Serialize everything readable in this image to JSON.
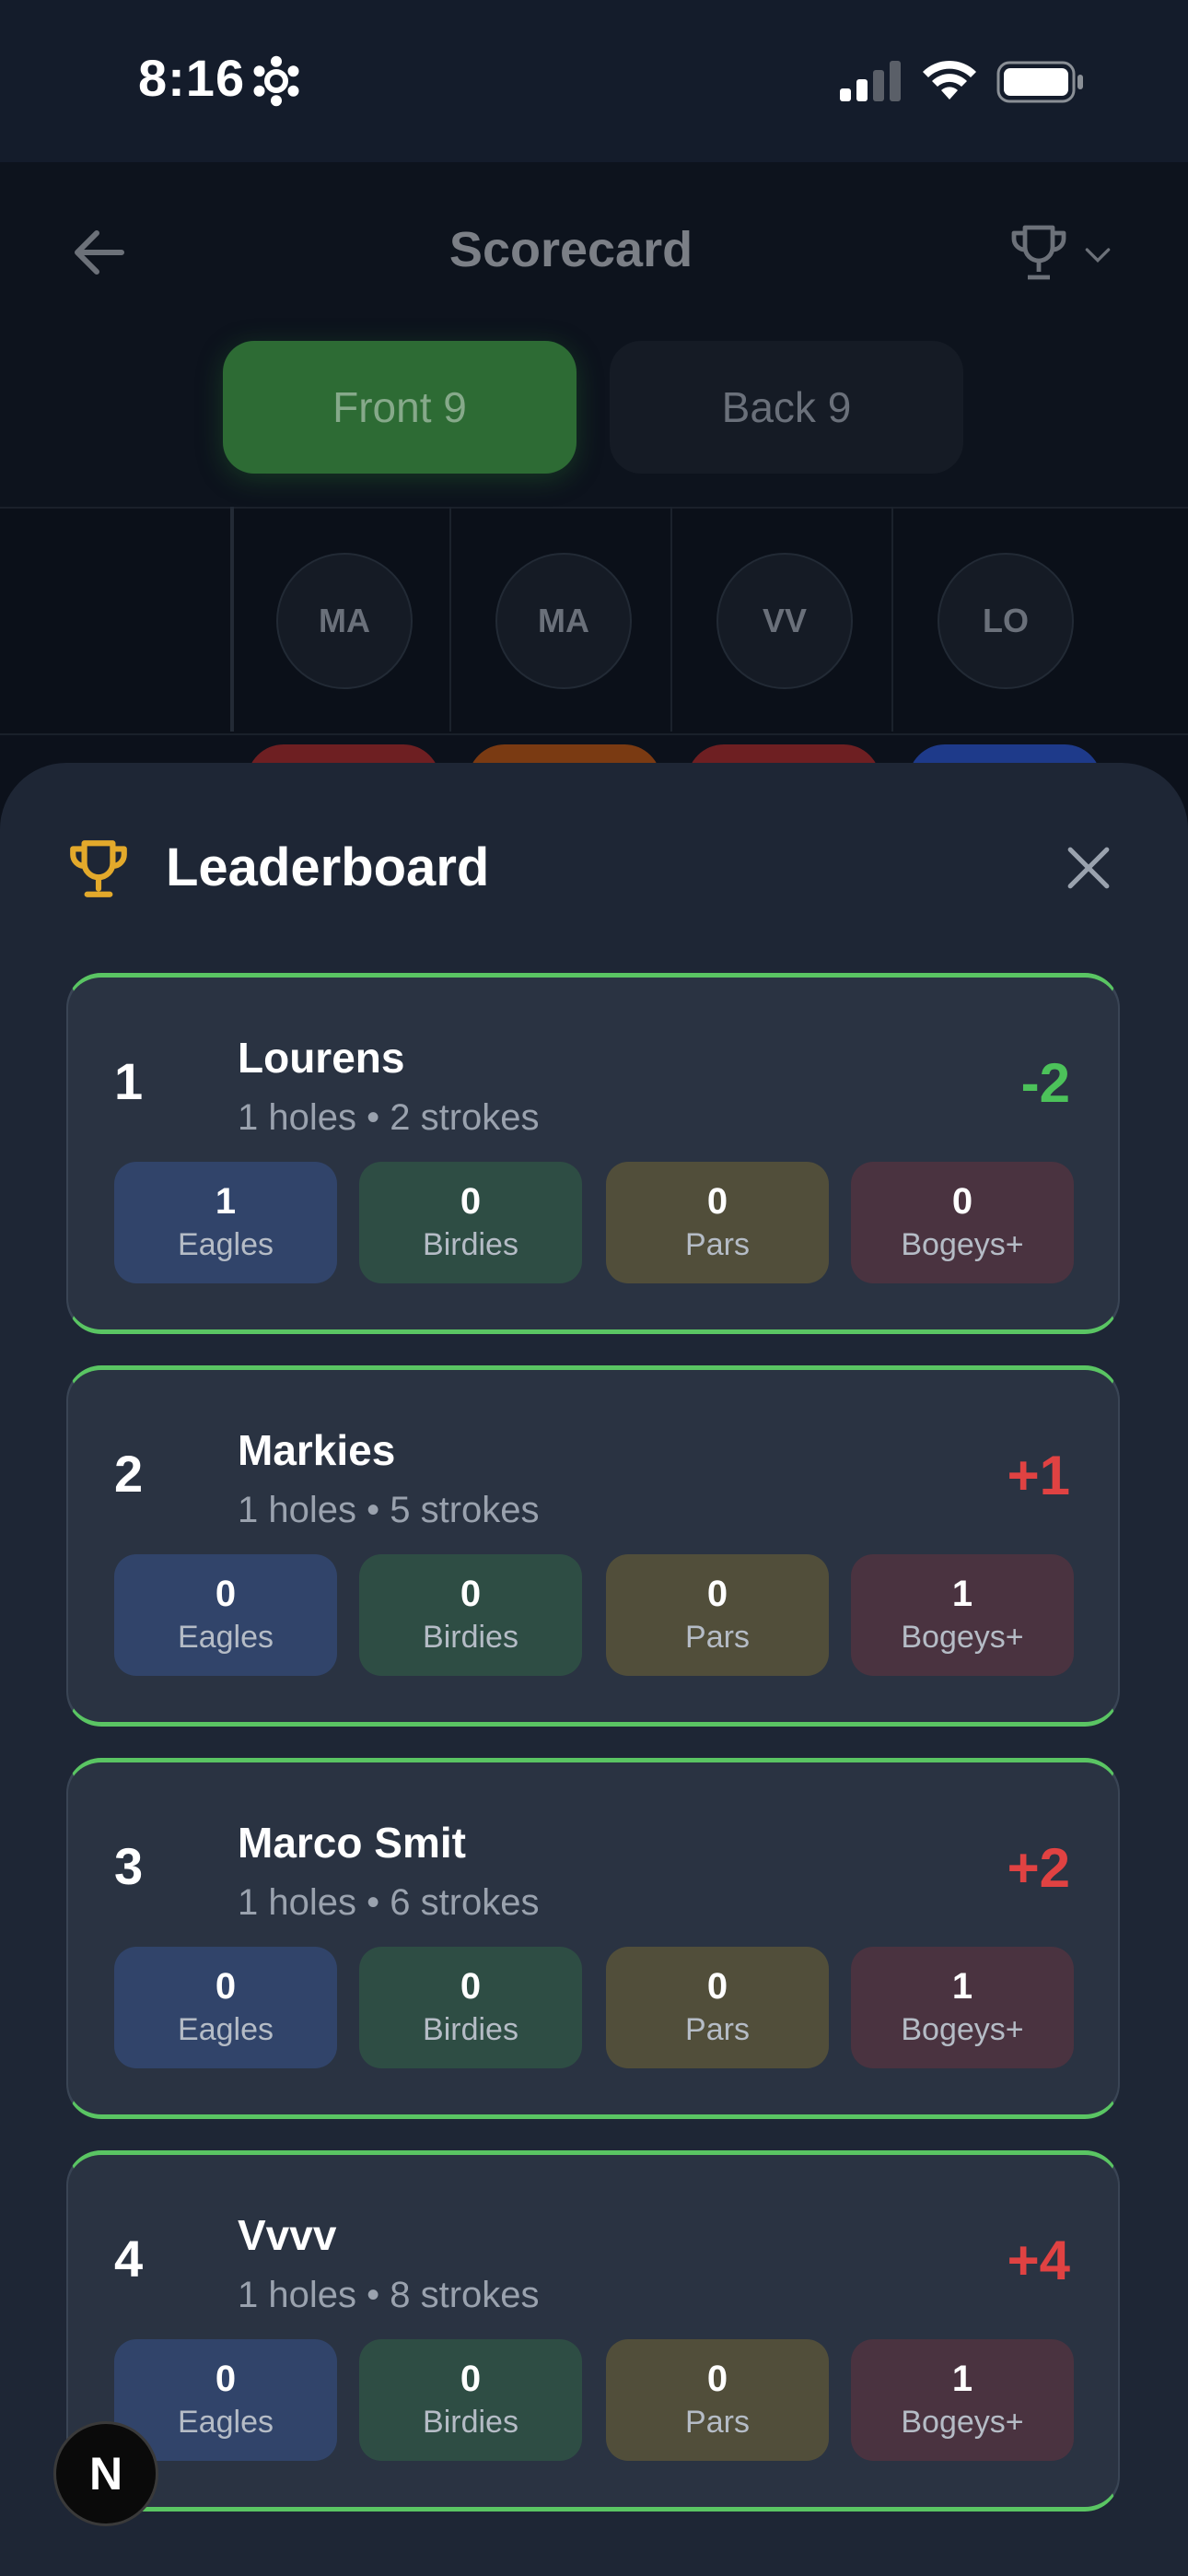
{
  "status_bar": {
    "time": "8:16"
  },
  "header": {
    "title": "Scorecard"
  },
  "tabs": [
    {
      "label": "Front 9",
      "active": true
    },
    {
      "label": "Back 9",
      "active": false
    }
  ],
  "players_initials": [
    "MA",
    "MA",
    "VV",
    "LO"
  ],
  "leaderboard": {
    "title": "Leaderboard",
    "entries": [
      {
        "rank": "1",
        "name": "Lourens",
        "sub": "1 holes • 2 strokes",
        "score": "-2",
        "stats": [
          {
            "value": "1",
            "label": "Eagles"
          },
          {
            "value": "0",
            "label": "Birdies"
          },
          {
            "value": "0",
            "label": "Pars"
          },
          {
            "value": "0",
            "label": "Bogeys+"
          }
        ]
      },
      {
        "rank": "2",
        "name": "Markies",
        "sub": "1 holes • 5 strokes",
        "score": "+1",
        "stats": [
          {
            "value": "0",
            "label": "Eagles"
          },
          {
            "value": "0",
            "label": "Birdies"
          },
          {
            "value": "0",
            "label": "Pars"
          },
          {
            "value": "1",
            "label": "Bogeys+"
          }
        ]
      },
      {
        "rank": "3",
        "name": "Marco Smit",
        "sub": "1 holes • 6 strokes",
        "score": "+2",
        "stats": [
          {
            "value": "0",
            "label": "Eagles"
          },
          {
            "value": "0",
            "label": "Birdies"
          },
          {
            "value": "0",
            "label": "Pars"
          },
          {
            "value": "1",
            "label": "Bogeys+"
          }
        ]
      },
      {
        "rank": "4",
        "name": "Vvvv",
        "sub": "1 holes • 8 strokes",
        "score": "+4",
        "stats": [
          {
            "value": "0",
            "label": "Eagles"
          },
          {
            "value": "0",
            "label": "Birdies"
          },
          {
            "value": "0",
            "label": "Pars"
          },
          {
            "value": "1",
            "label": "Bogeys+"
          }
        ]
      }
    ]
  },
  "badge": {
    "letter": "N"
  },
  "colors": {
    "accent_green": "#5ac563",
    "score_negative": "#4cc25a",
    "score_positive": "#e04242",
    "trophy": "#e3a92b"
  }
}
